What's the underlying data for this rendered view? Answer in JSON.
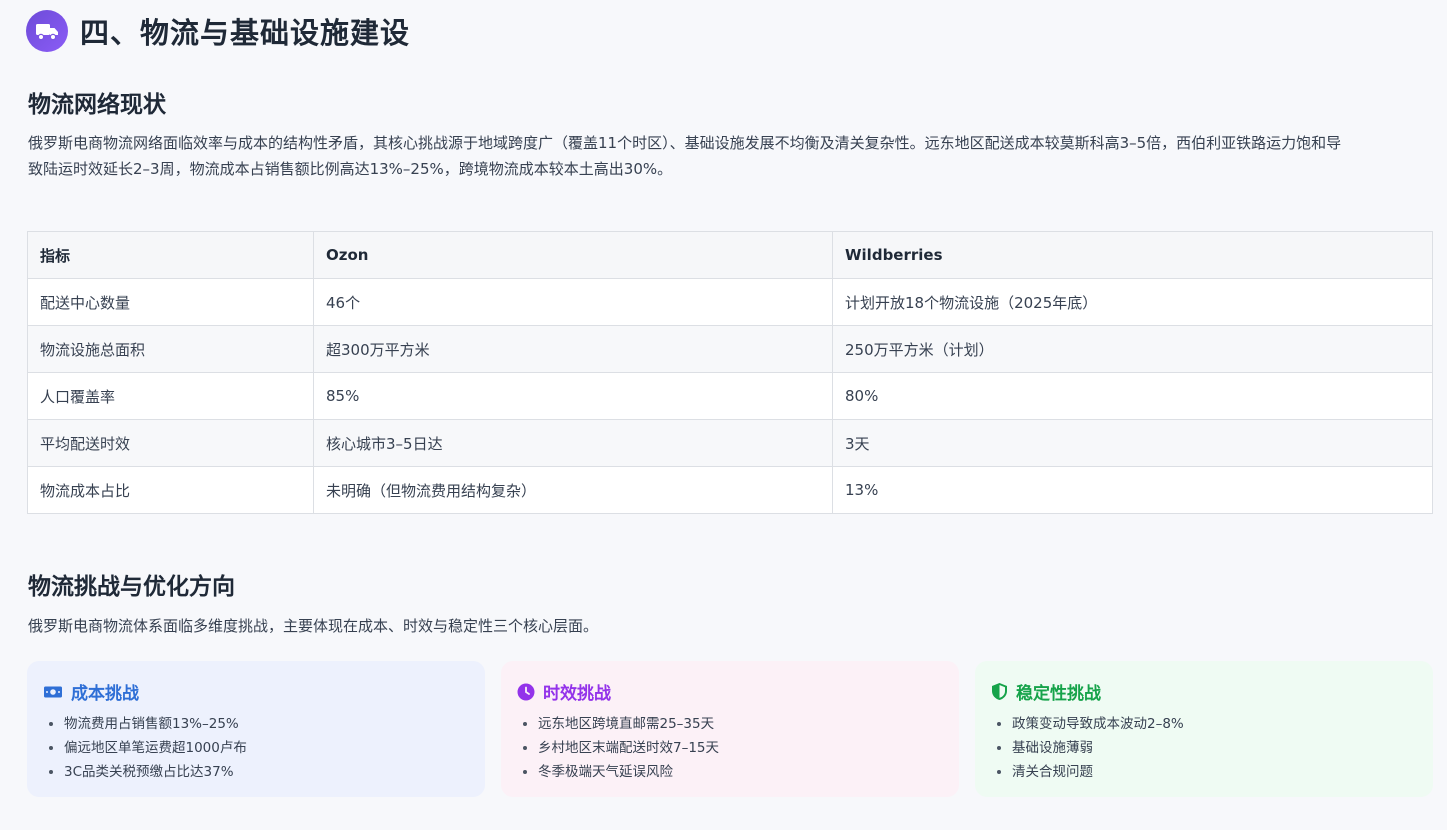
{
  "section": {
    "title": "四、物流与基础设施建设",
    "icon": "truck-icon"
  },
  "status": {
    "heading": "物流网络现状",
    "paragraph_line1": "俄罗斯电商物流网络面临效率与成本的结构性矛盾，其核心挑战源于地域跨度广（覆盖11个时区）、基础设施发展不均衡及清关复杂性。远东地区配送成本较莫斯科高3–5倍，西伯利亚铁路运力饱和导",
    "paragraph_line2": "致陆运时效延长2–3周，物流成本占销售额比例高达13%–25%，跨境物流成本较本土高出30%。"
  },
  "table": {
    "headers": [
      "指标",
      "Ozon",
      "Wildberries"
    ],
    "rows": [
      [
        "配送中心数量",
        "46个",
        "计划开放18个物流设施（2025年底）"
      ],
      [
        "物流设施总面积",
        "超300万平方米",
        "250万平方米（计划）"
      ],
      [
        "人口覆盖率",
        "85%",
        "80%"
      ],
      [
        "平均配送时效",
        "核心城市3–5日达",
        "3天"
      ],
      [
        "物流成本占比",
        "未明确（但物流费用结构复杂）",
        "13%"
      ]
    ]
  },
  "challenges": {
    "heading": "物流挑战与优化方向",
    "intro": "俄罗斯电商物流体系面临多维度挑战，主要体现在成本、时效与稳定性三个核心层面。",
    "cards": [
      {
        "title": "成本挑战",
        "icon": "money-icon",
        "color": "#2f6fd6",
        "items": [
          "物流费用占销售额13%–25%",
          "偏远地区单笔运费超1000卢布",
          "3C品类关税预缴占比达37%"
        ]
      },
      {
        "title": "时效挑战",
        "icon": "clock-icon",
        "color": "#9333ea",
        "items": [
          "远东地区跨境直邮需25–35天",
          "乡村地区末端配送时效7–15天",
          "冬季极端天气延误风险"
        ]
      },
      {
        "title": "稳定性挑战",
        "icon": "shield-icon",
        "color": "#16a34a",
        "items": [
          "政策变动导致成本波动2–8%",
          "基础设施薄弱",
          "清关合规问题"
        ]
      }
    ]
  }
}
